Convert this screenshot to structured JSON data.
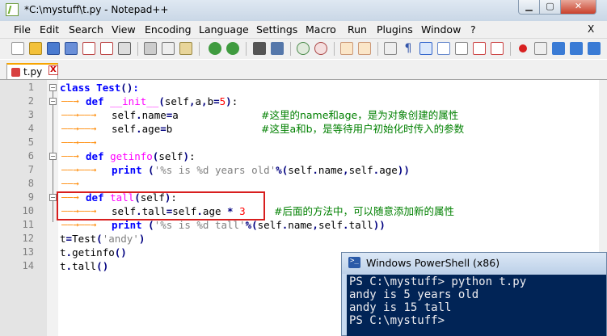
{
  "window": {
    "title": "*C:\\mystuff\\t.py - Notepad++"
  },
  "menu": {
    "items": [
      "File",
      "Edit",
      "Search",
      "View",
      "Encoding",
      "Language",
      "Settings",
      "Macro",
      "Run",
      "Plugins",
      "Window",
      "?"
    ],
    "close_label": "X"
  },
  "tab": {
    "label": "t.py",
    "close_label": "X"
  },
  "editor": {
    "line_numbers": [
      "1",
      "2",
      "3",
      "4",
      "5",
      "6",
      "7",
      "8",
      "9",
      "10",
      "11",
      "12",
      "13",
      "14"
    ],
    "lines": [
      {
        "no": "1",
        "code": "class Test():"
      },
      {
        "no": "2",
        "code": "def __init__(self,a,b=5):"
      },
      {
        "no": "3",
        "code": "self.name=a",
        "comment": "#这里的name和age，是为对象创建的属性"
      },
      {
        "no": "4",
        "code": "self.age=b",
        "comment": "#这里a和b，是等待用户初始化时传入的参数"
      },
      {
        "no": "5",
        "code": ""
      },
      {
        "no": "6",
        "code": "def getinfo(self):"
      },
      {
        "no": "7",
        "code": "print ('%s is %d years old'%(self.name,self.age))"
      },
      {
        "no": "8",
        "code": ""
      },
      {
        "no": "9",
        "code": "def tall(self):"
      },
      {
        "no": "10",
        "code": "self.tall=self.age * 3",
        "comment": "#后面的方法中，可以随意添加新的属性"
      },
      {
        "no": "11",
        "code": "print ('%s is %d tall'%(self.name,self.tall))"
      },
      {
        "no": "12",
        "code": "t=Test('andy')"
      },
      {
        "no": "13",
        "code": "t.getinfo()"
      },
      {
        "no": "14",
        "code": "t.tall()"
      }
    ]
  },
  "powershell": {
    "title": "Windows PowerShell (x86)",
    "console_lines": [
      "PS C:\\mystuff> python t.py",
      "andy is 5 years old",
      "andy is 15 tall",
      "PS C:\\mystuff>"
    ]
  },
  "colors": {
    "keyword": "#0000ff",
    "function_name": "#ff00ff",
    "string": "#808080",
    "number": "#ff0000",
    "comment": "#008000",
    "highlight_border": "#d81e1e",
    "ps_background": "#012456"
  }
}
